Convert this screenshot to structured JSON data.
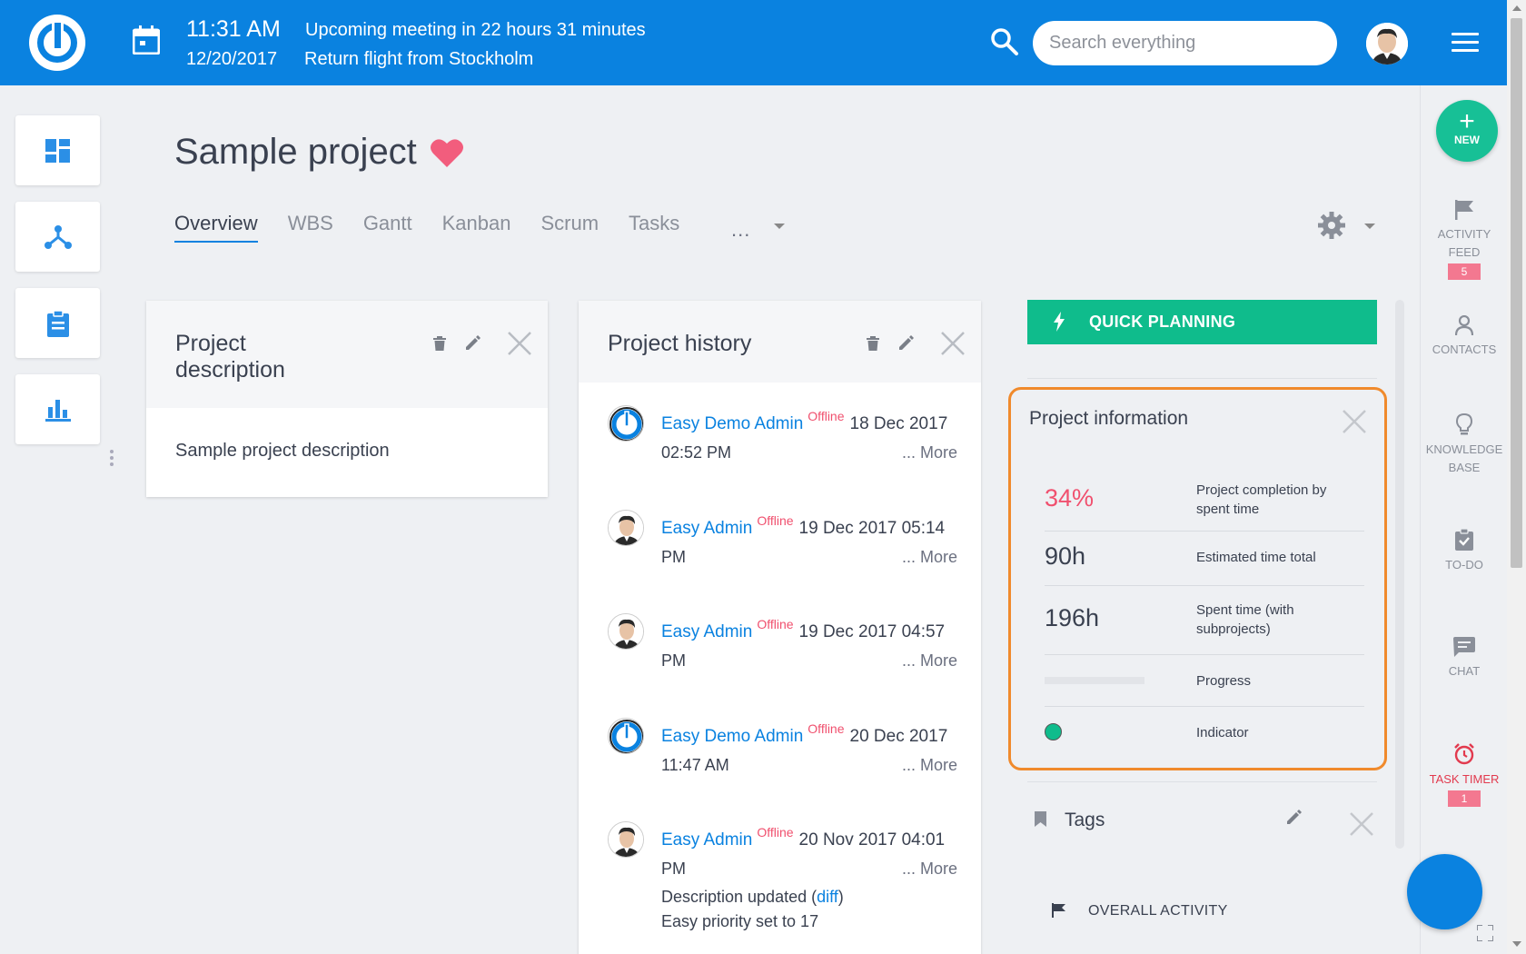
{
  "header": {
    "time": "11:31 AM",
    "date": "12/20/2017",
    "meeting": "Upcoming meeting in 22 hours 31 minutes",
    "flight": "Return flight from Stockholm",
    "search_placeholder": "Search everything"
  },
  "page": {
    "title": "Sample project",
    "tabs": [
      "Overview",
      "WBS",
      "Gantt",
      "Kanban",
      "Scrum",
      "Tasks"
    ],
    "tabs_more": "..."
  },
  "description_card": {
    "title": "Project description",
    "body": "Sample project description"
  },
  "history_card": {
    "title": "Project history",
    "more_label": "... More",
    "items": [
      {
        "user": "Easy Demo Admin",
        "status": "Offline",
        "date_a": "18 Dec 2017",
        "date_b": "02:52 PM",
        "avatar": "logo"
      },
      {
        "user": "Easy Admin",
        "status": "Offline",
        "date_a": "19 Dec 2017 05:14",
        "date_b": "PM",
        "avatar": "person"
      },
      {
        "user": "Easy Admin",
        "status": "Offline",
        "date_a": "19 Dec 2017 04:57",
        "date_b": "PM",
        "avatar": "person"
      },
      {
        "user": "Easy Demo Admin",
        "status": "Offline",
        "date_a": "20 Dec 2017",
        "date_b": "11:47 AM",
        "avatar": "logo"
      },
      {
        "user": "Easy Admin",
        "status": "Offline",
        "date_a": "20 Nov 2017 04:01",
        "date_b": "PM",
        "avatar": "person"
      }
    ],
    "extra_line1_prefix": "Description updated (",
    "extra_line1_link": "diff",
    "extra_line1_suffix": ")",
    "extra_line2": "Easy priority set to 17"
  },
  "right": {
    "quick_planning": "QUICK PLANNING",
    "info_title": "Project information",
    "info_rows": [
      {
        "value": "34%",
        "label": "Project completion by spent time"
      },
      {
        "value": "90h",
        "label": "Estimated time total"
      },
      {
        "value": "196h",
        "label": "Spent time (with subprojects)"
      },
      {
        "value": "",
        "label": "Progress"
      },
      {
        "value": "",
        "label": "Indicator"
      }
    ],
    "progress_fraction": 0.0,
    "indicator_color": "#0fbc8c",
    "completion_color": "#f0506e",
    "tags_title": "Tags",
    "overall_activity": "OVERALL ACTIVITY"
  },
  "rail": {
    "new_label": "NEW",
    "activity_feed_1": "ACTIVITY",
    "activity_feed_2": "FEED",
    "activity_badge": "5",
    "contacts": "CONTACTS",
    "kb_1": "KNOWLEDGE",
    "kb_2": "BASE",
    "todo": "TO-DO",
    "chat": "CHAT",
    "timer": "TASK TIMER",
    "timer_badge": "1"
  },
  "colors": {
    "brand_blue": "#0a82e0",
    "green": "#0fbc8c",
    "highlight": "#f08a2c"
  }
}
